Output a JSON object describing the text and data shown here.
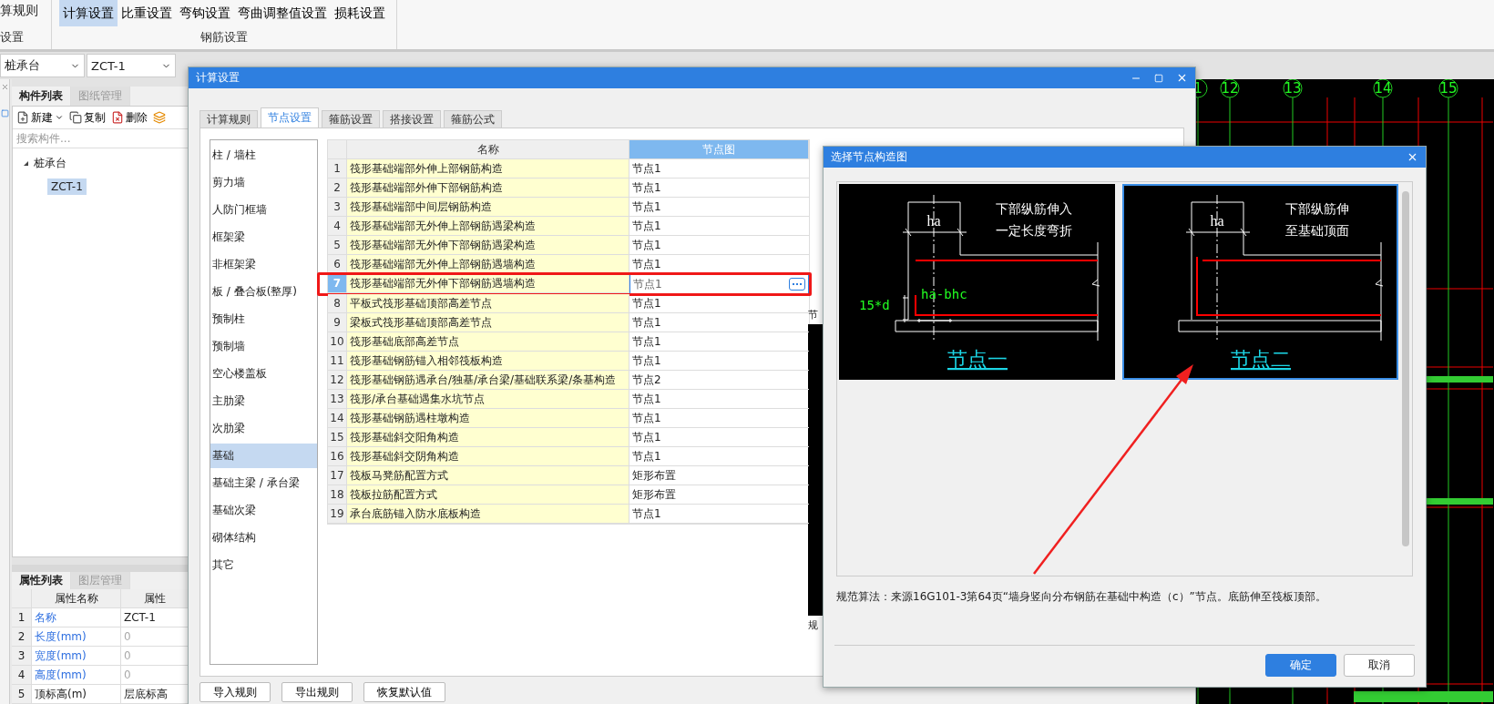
{
  "ribbon": {
    "cut_label": "算规则",
    "cut_group": "设置",
    "buttons": [
      {
        "label": "计算设置",
        "selected": true
      },
      {
        "label": "比重设置",
        "selected": false
      },
      {
        "label": "弯钩设置",
        "selected": false
      },
      {
        "label": "弯曲调整值设置",
        "selected": false
      },
      {
        "label": "损耗设置",
        "selected": false
      }
    ],
    "group": "钢筋设置"
  },
  "selectors": [
    "桩承台",
    "ZCT-1"
  ],
  "component_panel": {
    "tabs": [
      {
        "label": "构件列表",
        "selected": true
      },
      {
        "label": "图纸管理",
        "selected": false
      }
    ],
    "toolbar": [
      {
        "kind": "new",
        "label": "新建"
      },
      {
        "kind": "copy",
        "label": "复制"
      },
      {
        "kind": "delete",
        "label": "删除"
      },
      {
        "kind": "layer"
      }
    ],
    "search": {
      "placeholder": "搜索构件..."
    },
    "tree": [
      {
        "label": "桩承台",
        "expanded": true,
        "selected": false,
        "children": [
          {
            "label": "ZCT-1",
            "selected": true
          }
        ]
      }
    ]
  },
  "property_panel": {
    "tabs": [
      {
        "label": "属性列表",
        "selected": true
      },
      {
        "label": "图层管理",
        "selected": false
      }
    ],
    "columns": [
      "属性名称",
      "属性"
    ],
    "rows": [
      {
        "index": "1",
        "name": "名称",
        "value": "ZCT-1",
        "public": true,
        "readonly": false
      },
      {
        "index": "2",
        "name": "长度(mm)",
        "value": "0",
        "public": true,
        "readonly": true
      },
      {
        "index": "3",
        "name": "宽度(mm)",
        "value": "0",
        "public": true,
        "readonly": true
      },
      {
        "index": "4",
        "name": "高度(mm)",
        "value": "0",
        "public": true,
        "readonly": true
      },
      {
        "index": "5",
        "name": "顶标高(m)",
        "value": "层底标高",
        "public": false,
        "readonly": false
      }
    ]
  },
  "canvas": {
    "axis_labels": [
      "1",
      "12",
      "13",
      "14",
      "15"
    ]
  },
  "settings_dialog": {
    "title": "计算设置",
    "tabs": [
      {
        "label": "计算规则",
        "selected": false
      },
      {
        "label": "节点设置",
        "selected": true
      },
      {
        "label": "箍筋设置",
        "selected": false
      },
      {
        "label": "搭接设置",
        "selected": false
      },
      {
        "label": "箍筋公式",
        "selected": false
      }
    ],
    "categories": [
      {
        "label": "柱 / 墙柱",
        "selected": false
      },
      {
        "label": "剪力墙",
        "selected": false
      },
      {
        "label": "人防门框墙",
        "selected": false
      },
      {
        "label": "框架梁",
        "selected": false
      },
      {
        "label": "非框架梁",
        "selected": false
      },
      {
        "label": "板 / 叠合板(整厚)",
        "selected": false
      },
      {
        "label": "预制柱",
        "selected": false
      },
      {
        "label": "预制墙",
        "selected": false
      },
      {
        "label": "空心楼盖板",
        "selected": false
      },
      {
        "label": "主肋梁",
        "selected": false
      },
      {
        "label": "次肋梁",
        "selected": false
      },
      {
        "label": "基础",
        "selected": true
      },
      {
        "label": "基础主梁 / 承台梁",
        "selected": false
      },
      {
        "label": "基础次梁",
        "selected": false
      },
      {
        "label": "砌体结构",
        "selected": false
      },
      {
        "label": "其它",
        "selected": false
      }
    ],
    "table": {
      "columns": [
        {
          "label": "名称",
          "selected": false
        },
        {
          "label": "节点图",
          "selected": true
        }
      ],
      "rows": [
        {
          "index": "1",
          "name": "筏形基础端部外伸上部钢筋构造",
          "node": "节点1",
          "selected": false
        },
        {
          "index": "2",
          "name": "筏形基础端部外伸下部钢筋构造",
          "node": "节点1",
          "selected": false
        },
        {
          "index": "3",
          "name": "筏形基础端部中间层钢筋构造",
          "node": "节点1",
          "selected": false
        },
        {
          "index": "4",
          "name": "筏形基础端部无外伸上部钢筋遇梁构造",
          "node": "节点1",
          "selected": false
        },
        {
          "index": "5",
          "name": "筏形基础端部无外伸下部钢筋遇梁构造",
          "node": "节点1",
          "selected": false
        },
        {
          "index": "6",
          "name": "筏形基础端部无外伸上部钢筋遇墙构造",
          "node": "节点1",
          "selected": false
        },
        {
          "index": "7",
          "name": "筏形基础端部无外伸下部钢筋遇墙构造",
          "node": "节点1",
          "selected": true
        },
        {
          "index": "8",
          "name": "平板式筏形基础顶部高差节点",
          "node": "节点1",
          "selected": false
        },
        {
          "index": "9",
          "name": "梁板式筏形基础顶部高差节点",
          "node": "节点1",
          "selected": false
        },
        {
          "index": "10",
          "name": "筏形基础底部高差节点",
          "node": "节点1",
          "selected": false
        },
        {
          "index": "11",
          "name": "筏形基础钢筋锚入相邻筏板构造",
          "node": "节点1",
          "selected": false
        },
        {
          "index": "12",
          "name": "筏形基础钢筋遇承台/独基/承台梁/基础联系梁/条基构造",
          "node": "节点2",
          "selected": false
        },
        {
          "index": "13",
          "name": "筏形/承台基础遇集水坑节点",
          "node": "节点1",
          "selected": false
        },
        {
          "index": "14",
          "name": "筏形基础钢筋遇柱墩构造",
          "node": "节点1",
          "selected": false
        },
        {
          "index": "15",
          "name": "筏形基础斜交阳角构造",
          "node": "节点1",
          "selected": false
        },
        {
          "index": "16",
          "name": "筏形基础斜交阴角构造",
          "node": "节点1",
          "selected": false
        },
        {
          "index": "17",
          "name": "筏板马凳筋配置方式",
          "node": "矩形布置",
          "selected": false
        },
        {
          "index": "18",
          "name": "筏板拉筋配置方式",
          "node": "矩形布置",
          "selected": false
        },
        {
          "index": "19",
          "name": "承台底筋锚入防水底板构造",
          "node": "节点1",
          "selected": false
        }
      ]
    },
    "preview": {
      "label": "节",
      "caption": "规"
    },
    "buttons": [
      "导入规则",
      "导出规则",
      "恢复默认值"
    ]
  },
  "node_dialog": {
    "title": "选择节点构造图",
    "options": [
      {
        "kind": "bend",
        "lines": [
          "下部纵筋伸入",
          "一定长度弯折"
        ],
        "dim": "ha",
        "labels": [
          "15*d",
          "ha-bhc"
        ],
        "caption": "节点一",
        "selected": false
      },
      {
        "kind": "through",
        "lines": [
          "下部纵筋伸",
          "至基础顶面"
        ],
        "dim": "ha",
        "caption": "节点二",
        "selected": true
      }
    ],
    "note": "规范算法：来源16G101-3第64页“墙身竖向分布钢筋在基础中构造（c）”节点。底筋伸至筏板顶部。",
    "buttons": [
      {
        "label": "确定",
        "primary": true
      },
      {
        "label": "取消",
        "primary": false
      }
    ]
  }
}
